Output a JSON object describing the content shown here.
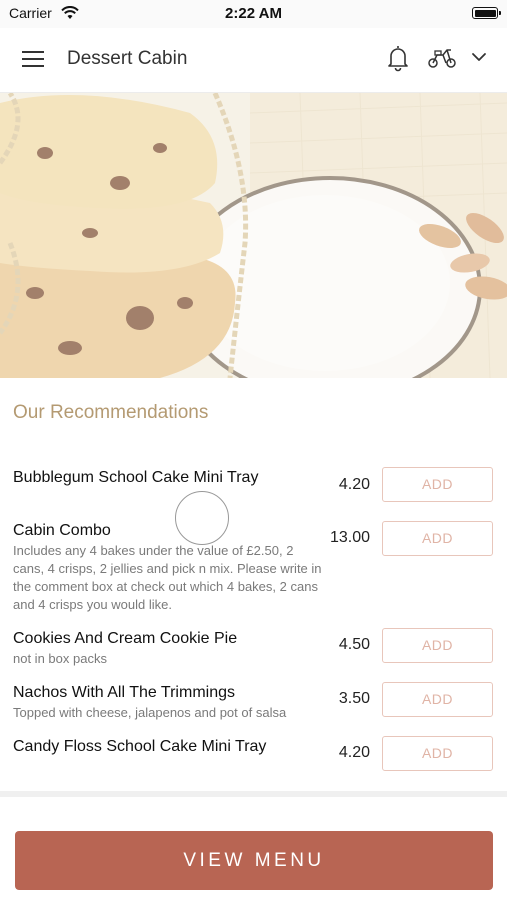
{
  "status_bar": {
    "carrier": "Carrier",
    "time": "2:22 AM"
  },
  "header": {
    "title": "Dessert Cabin",
    "icons": [
      "menu-icon",
      "bell-icon",
      "scooter-icon",
      "chevron-down-icon"
    ]
  },
  "hero": {
    "image": "cookies-and-almonds-photo"
  },
  "recommendations": {
    "title": "Our Recommendations",
    "items": [
      {
        "name": "Bubblegum School Cake Mini Tray",
        "description": "",
        "price": "4.20",
        "add_label": "ADD"
      },
      {
        "name": "Cabin Combo",
        "description": "Includes any 4 bakes under the value of £2.50, 2 cans, 4 crisps, 2 jellies and pick n mix. Please write in the comment box at check out which 4 bakes, 2 cans and 4 crisps you would like.",
        "price": "13.00",
        "add_label": "ADD"
      },
      {
        "name": "Cookies And Cream Cookie Pie",
        "description": "not in box packs",
        "price": "4.50",
        "add_label": "ADD"
      },
      {
        "name": "Nachos With All The Trimmings",
        "description": "Topped with cheese, jalapenos and pot of salsa",
        "price": "3.50",
        "add_label": "ADD"
      },
      {
        "name": "Candy Floss School Cake Mini Tray",
        "description": "",
        "price": "4.20",
        "add_label": "ADD"
      }
    ]
  },
  "footer": {
    "view_menu_label": "VIEW MENU"
  },
  "colors": {
    "accent": "#b86553",
    "section_title": "#b49a72",
    "add_border": "#e8c6bb"
  }
}
